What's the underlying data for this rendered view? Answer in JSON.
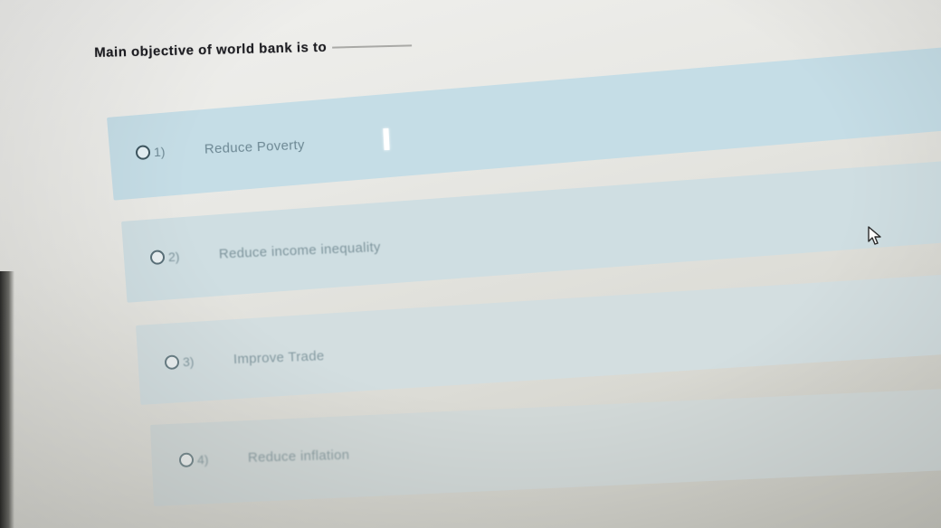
{
  "question": {
    "text": "Main objective of world bank is to"
  },
  "options": [
    {
      "number": "1)",
      "label": "Reduce Poverty",
      "selected": false
    },
    {
      "number": "2)",
      "label": "Reduce income inequality",
      "selected": false
    },
    {
      "number": "3)",
      "label": "Improve Trade",
      "selected": false
    },
    {
      "number": "4)",
      "label": "Reduce inflation",
      "selected": false
    }
  ],
  "colors": {
    "option_bar": "#c5dde6",
    "option_text": "#6d8894",
    "question_text": "#1d1d22"
  },
  "icons": {
    "radio": "radio-button-icon",
    "cursor": "mouse-pointer-icon"
  }
}
